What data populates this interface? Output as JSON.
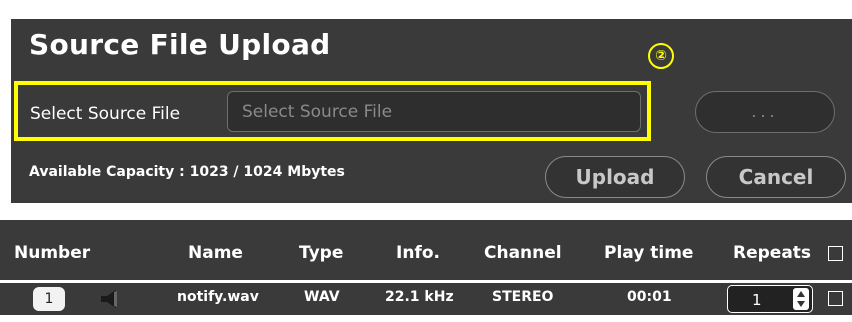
{
  "upload_panel": {
    "title": "Source File Upload",
    "step_marker": "②",
    "select_label": "Select Source File",
    "file_input": {
      "value": "",
      "placeholder": "Select Source File"
    },
    "browse_label": "...",
    "capacity_text": "Available Capacity : 1023 / 1024 Mbytes",
    "upload_label": "Upload",
    "cancel_label": "Cancel"
  },
  "table": {
    "headers": {
      "number": "Number",
      "name": "Name",
      "type": "Type",
      "info": "Info.",
      "channel": "Channel",
      "play_time": "Play time",
      "repeats": "Repeats"
    },
    "rows": [
      {
        "number": "1",
        "icon": "speaker-icon",
        "name": "notify.wav",
        "type": "WAV",
        "info": "22.1 kHz",
        "channel": "STEREO",
        "play_time": "00:01",
        "repeats": "1"
      }
    ]
  },
  "colors": {
    "panel_bg": "#3a3a3a",
    "highlight": "#ffff00",
    "text": "#ffffff"
  }
}
